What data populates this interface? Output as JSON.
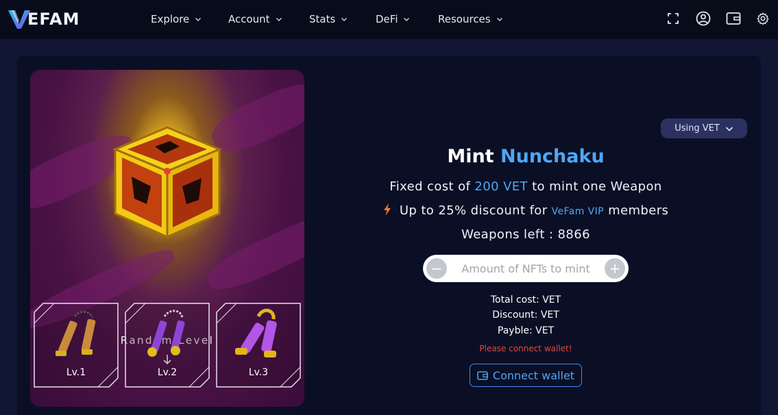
{
  "brand": {
    "logo_text": "EFAM",
    "logo_icon": "vefam-v-logo"
  },
  "nav": {
    "items": [
      {
        "label": "Explore"
      },
      {
        "label": "Account"
      },
      {
        "label": "Stats"
      },
      {
        "label": "DeFi"
      },
      {
        "label": "Resources"
      }
    ],
    "icons": [
      "fullscreen-icon",
      "user-icon",
      "wallet-icon",
      "settings-icon"
    ]
  },
  "artwork": {
    "random_level_label": "Random Level",
    "levels": [
      {
        "label": "Lv.1",
        "color": "#c98a3c"
      },
      {
        "label": "Lv.2",
        "color": "#8e45d6"
      },
      {
        "label": "Lv.3",
        "color": "#b256e8"
      }
    ]
  },
  "mint": {
    "currency_selector": "Using VET",
    "title_prefix": "Mint",
    "title_item": "Nunchaku",
    "fixed_cost_prefix": "Fixed cost of",
    "fixed_cost_value": "200 VET",
    "fixed_cost_suffix": "to mint one Weapon",
    "discount_prefix": "Up to 25% discount for",
    "discount_program": "VeFam VIP",
    "discount_suffix": "members",
    "weapons_left": "Weapons left : 8866",
    "amount_placeholder": "Amount of NFTs to mint",
    "minus": "−",
    "plus": "+",
    "total_cost": "Total cost: VET",
    "discount": "Discount: VET",
    "payable": "Payble: VET",
    "warning": "Please connect wallet!",
    "connect_button": "Connect wallet"
  },
  "colors": {
    "accent": "#4fa7f2",
    "warning": "#e0483f",
    "nav_bg": "#070b1a",
    "panel_bg": "#0b0f25"
  }
}
